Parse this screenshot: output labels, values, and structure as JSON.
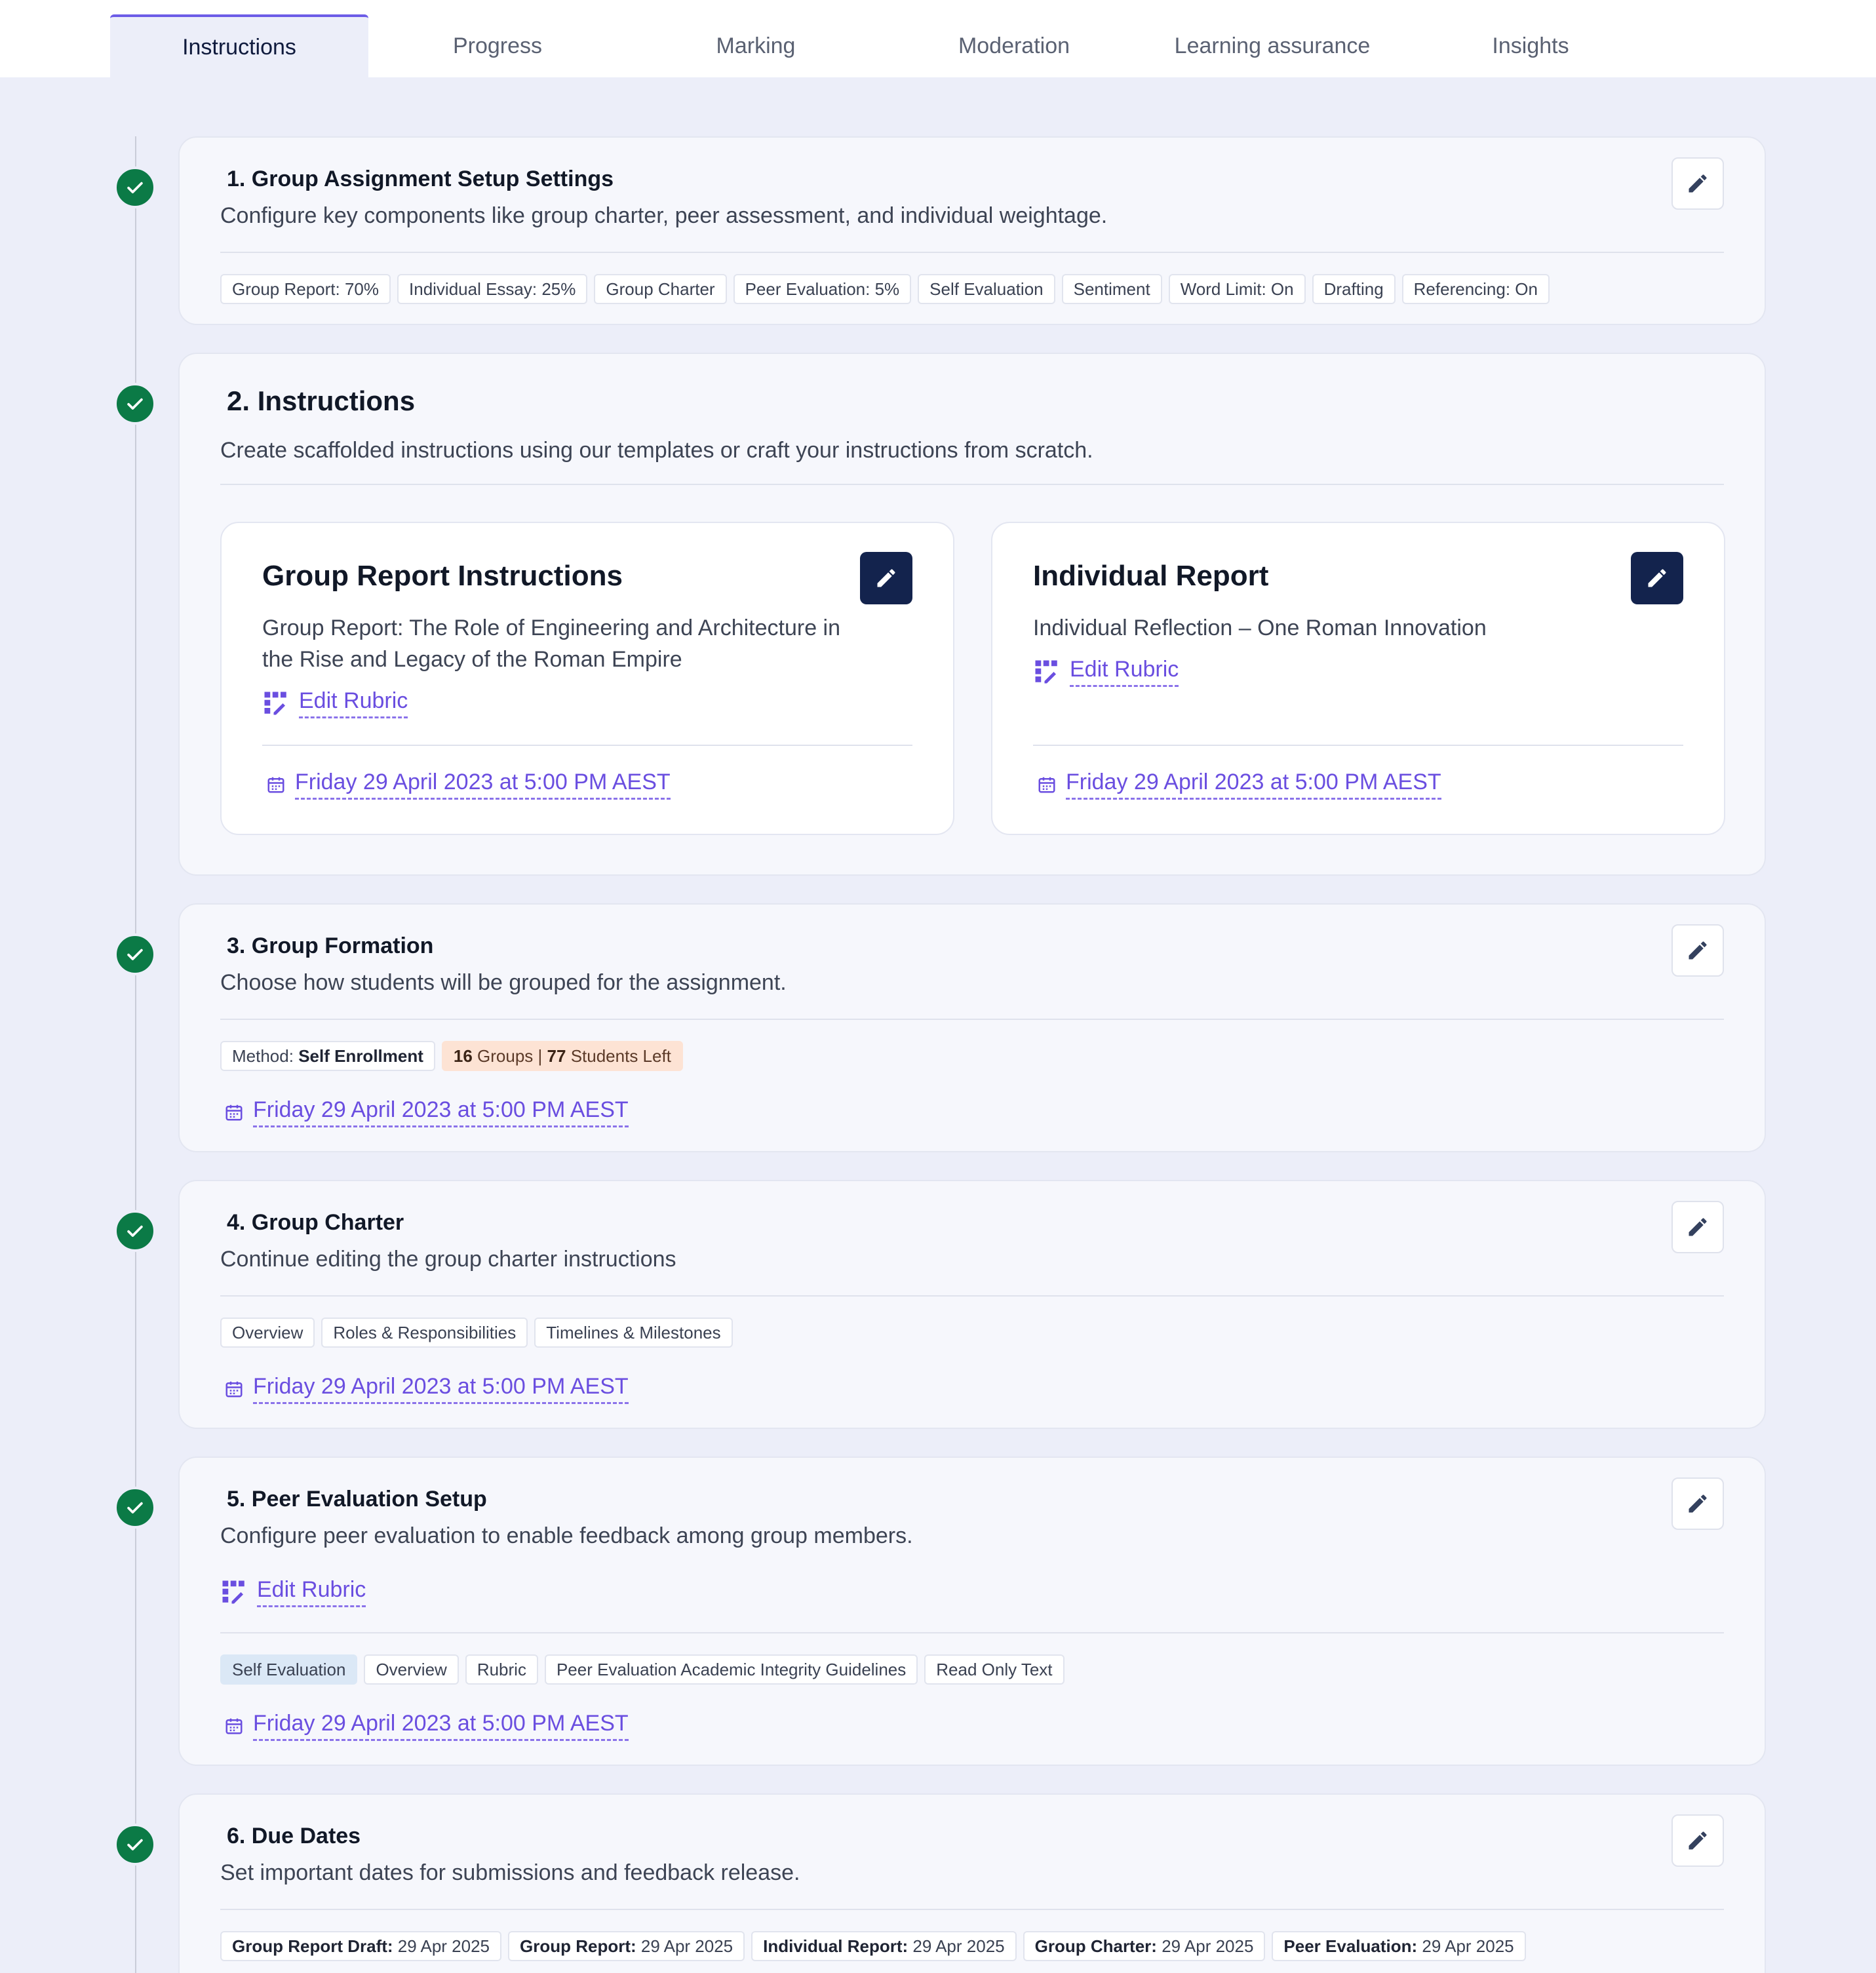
{
  "tabs": [
    {
      "label": "Instructions",
      "active": true
    },
    {
      "label": "Progress"
    },
    {
      "label": "Marking"
    },
    {
      "label": "Moderation"
    },
    {
      "label": "Learning assurance"
    },
    {
      "label": "Insights"
    }
  ],
  "colors": {
    "accent": "#6c5ce7",
    "link": "#6a4ee0",
    "success": "#0b7a46",
    "dark_button": "#13234d"
  },
  "step1": {
    "title": "1. Group Assignment Setup Settings",
    "desc": "Configure key components like group charter, peer assessment, and individual weightage.",
    "chips": [
      "Group Report: 70%",
      "Individual Essay: 25%",
      "Group Charter",
      "Peer Evaluation: 5%",
      "Self Evaluation",
      "Sentiment",
      "Word Limit: On",
      "Drafting",
      "Referencing: On"
    ]
  },
  "step2": {
    "title": "2. Instructions",
    "desc": "Create scaffolded instructions using our templates or craft your instructions from scratch.",
    "group_report": {
      "title": "Group Report Instructions",
      "desc": "Group Report: The Role of Engineering and Architecture in the Rise and Legacy of the Roman Empire",
      "rubric": "Edit Rubric",
      "date": "Friday 29 April 2023 at 5:00 PM AEST"
    },
    "individual_report": {
      "title": "Individual Report",
      "desc": "Individual Reflection – One Roman Innovation",
      "rubric": "Edit Rubric",
      "date": "Friday 29 April 2023 at 5:00 PM AEST"
    }
  },
  "step3": {
    "title": "3. Group Formation",
    "desc": "Choose how students will be grouped for the assignment.",
    "method_label": "Method:",
    "method_value": "Self Enrollment",
    "groups_count": "16",
    "groups_label": "Groups |",
    "students_count": "77",
    "students_label": "Students Left",
    "date": "Friday 29 April 2023 at 5:00 PM AEST"
  },
  "step4": {
    "title": "4. Group Charter",
    "desc": "Continue editing the group charter instructions",
    "chips": [
      "Overview",
      "Roles & Responsibilities",
      "Timelines & Milestones"
    ],
    "date": "Friday 29 April 2023 at 5:00 PM AEST"
  },
  "step5": {
    "title": "5. Peer Evaluation Setup",
    "desc": "Configure peer evaluation to enable feedback among group members.",
    "rubric": "Edit Rubric",
    "chips": [
      "Self Evaluation",
      "Overview",
      "Rubric",
      "Peer Evaluation Academic Integrity Guidelines",
      "Read Only Text"
    ],
    "date": "Friday 29 April 2023 at 5:00 PM AEST"
  },
  "step6": {
    "title": "6. Due Dates",
    "desc": "Set important dates for submissions and feedback release.",
    "chips": [
      {
        "label": "Group Report Draft:",
        "value": "29 Apr 2025"
      },
      {
        "label": "Group Report:",
        "value": "29 Apr 2025"
      },
      {
        "label": "Individual Report:",
        "value": "29 Apr 2025"
      },
      {
        "label": "Group Charter:",
        "value": "29 Apr 2025"
      },
      {
        "label": "Peer Evaluation:",
        "value": "29 Apr 2025"
      }
    ]
  }
}
